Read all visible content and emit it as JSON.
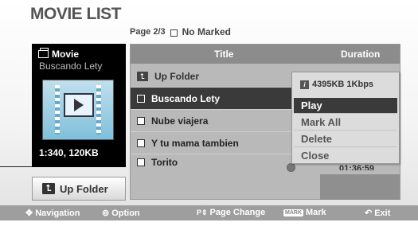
{
  "screen_title": "MOVIE LIST",
  "page_info": {
    "page": "Page 2/3",
    "marked": "No Marked"
  },
  "preview": {
    "category": "Movie",
    "filename": "Buscando Lety",
    "info": "1:340, 120KB"
  },
  "list": {
    "col_title": "Title",
    "col_duration": "Duration",
    "up_folder": "Up Folder",
    "items": [
      {
        "title": "Buscando Lety",
        "selected": true
      },
      {
        "title": "Nube viajera",
        "selected": false
      },
      {
        "title": "Y tu mama tambien",
        "selected": false
      },
      {
        "title": "Torito",
        "selected": false
      }
    ],
    "duration_peek": "01:36:59"
  },
  "popup": {
    "header": "4395KB 1Kbps",
    "items": [
      "Play",
      "Mark All",
      "Delete",
      "Close"
    ],
    "active_index": 0
  },
  "up_folder_button": "Up Folder",
  "footer": {
    "navigation": "Navigation",
    "option": "Option",
    "page_change": "Page Change",
    "mark_badge": "MARK",
    "mark": "Mark",
    "exit": "Exit"
  },
  "colors": {
    "selection": "#3a3a3a",
    "panel_bg": "#b9b9b9",
    "header_bg": "#8c8c8c",
    "footer_bg": "#9e9e9e"
  }
}
